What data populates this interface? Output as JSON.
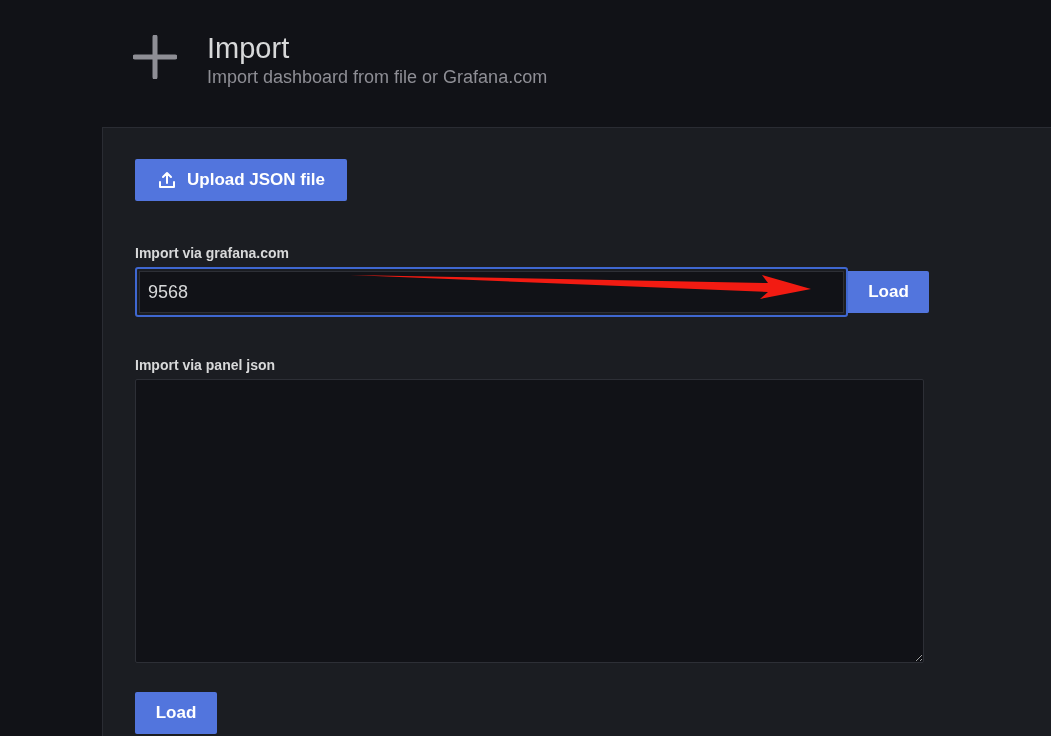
{
  "header": {
    "title": "Import",
    "subtitle": "Import dashboard from file or Grafana.com"
  },
  "upload_button": {
    "label": "Upload JSON file"
  },
  "grafana_import": {
    "label": "Import via grafana.com",
    "value": "9568",
    "button": "Load"
  },
  "panel_json": {
    "label": "Import via panel json"
  },
  "load_button": {
    "label": "Load"
  }
}
